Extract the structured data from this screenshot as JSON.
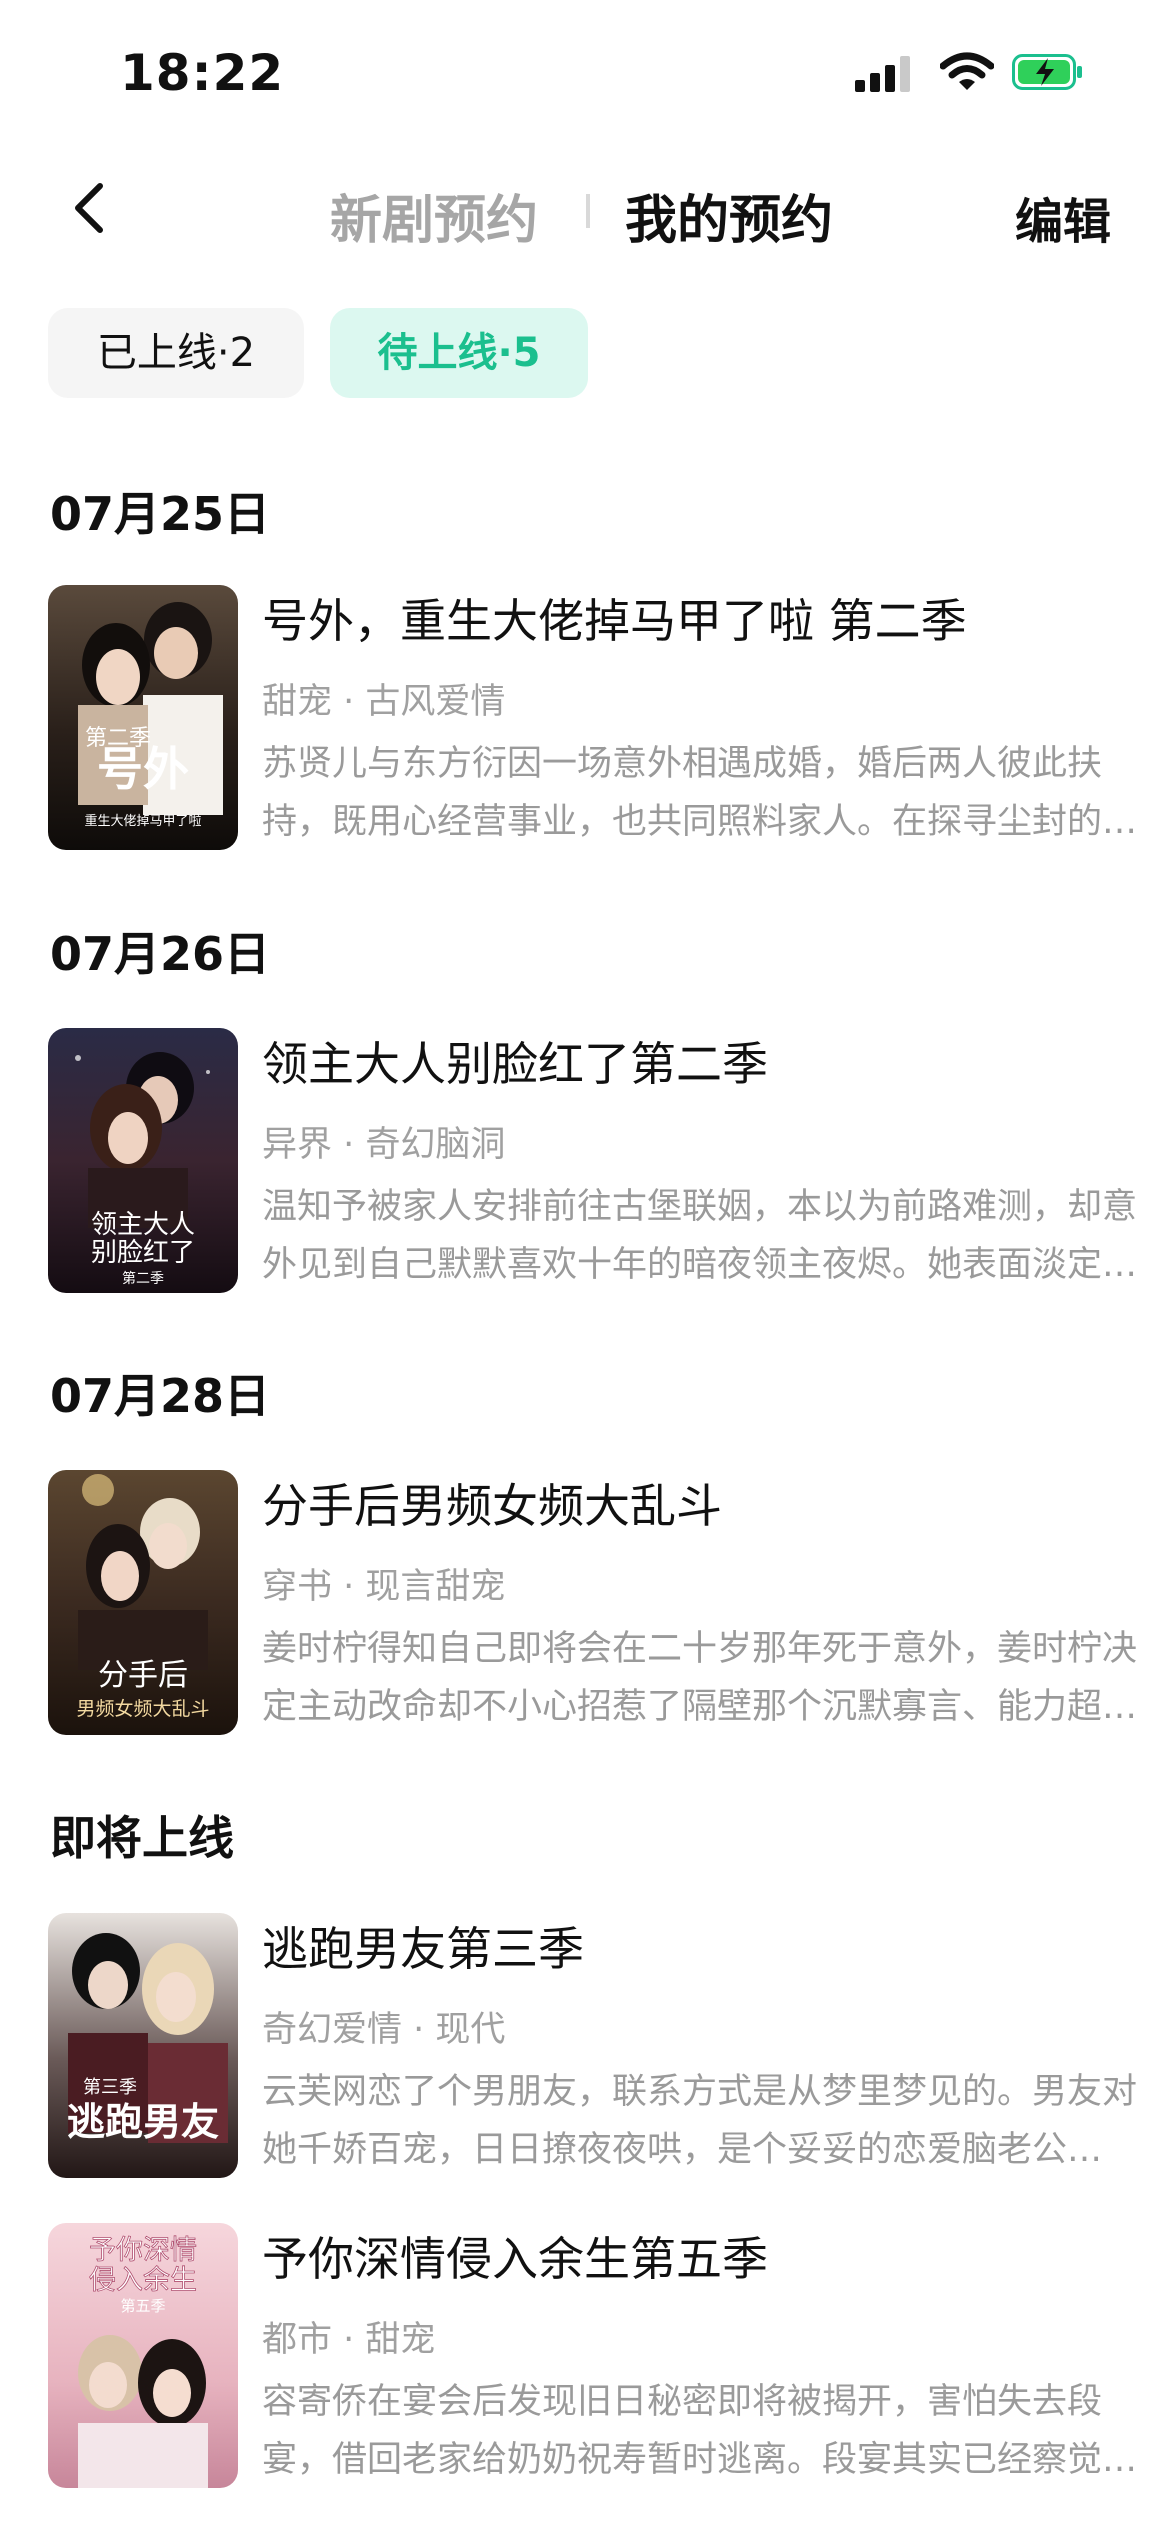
{
  "status": {
    "time": "18:22"
  },
  "nav": {
    "tab_new": "新剧预约",
    "tab_mine": "我的预约",
    "edit": "编辑"
  },
  "filters": {
    "online": "已上线·2",
    "upcoming": "待上线·5"
  },
  "sections": [
    {
      "date": "07月25日",
      "item": {
        "title": "号外，重生大佬掉马甲了啦 第二季",
        "tags": "甜宠 · 古风爱情",
        "desc": "苏贤儿与东方衍因一场意外相遇成婚，婚后两人彼此扶持，既用心经营事业，也共同照料家人。在探寻尘封的往事中…",
        "poster_title": "号外",
        "poster_sub": "第二季",
        "poster_caption": "重生大佬掉马甲了啦"
      }
    },
    {
      "date": "07月26日",
      "item": {
        "title": "领主大人别脸红了第二季",
        "tags": "异界 · 奇幻脑洞",
        "desc": "温知予被家人安排前往古堡联姻，本以为前路难测，却意外见到自己默默喜欢十年的暗夜领主夜烬。她表面淡定…",
        "poster_title": "领主大人\n别脸红了",
        "poster_sub": "第二季"
      }
    },
    {
      "date": "07月28日",
      "item": {
        "title": "分手后男频女频大乱斗",
        "tags": "穿书 · 现言甜宠",
        "desc": "姜时柠得知自己即将会在二十岁那年死于意外，姜时柠决定主动改命却不小心招惹了隔壁那个沉默寡言、能力超群…",
        "poster_title": "分手后",
        "poster_sub": "男频女频大乱斗"
      }
    },
    {
      "date": "即将上线",
      "item": {
        "title": "逃跑男友第三季",
        "tags": "奇幻爱情 · 现代",
        "desc": "云芙网恋了个男朋友，联系方式是从梦里梦见的。男友对她千娇百宠，日日撩夜夜哄，是个妥妥的恋爱脑老公…",
        "poster_title": "逃跑男友",
        "poster_sub": "第三季"
      },
      "item2": {
        "title": "予你深情侵入余生第五季",
        "tags": "都市 · 甜宠",
        "desc": "容寄侨在宴会后发现旧日秘密即将被揭开，害怕失去段宴，借回老家给奶奶祝寿暂时逃离。段宴其实已经察觉一切…",
        "poster_title": "予你深情\n侵入余生",
        "poster_sub": "第五季"
      }
    }
  ],
  "colors": {
    "accent": "#1bbf8e",
    "chip_active_bg": "#dcf8f0",
    "muted": "#a0a0a0"
  }
}
